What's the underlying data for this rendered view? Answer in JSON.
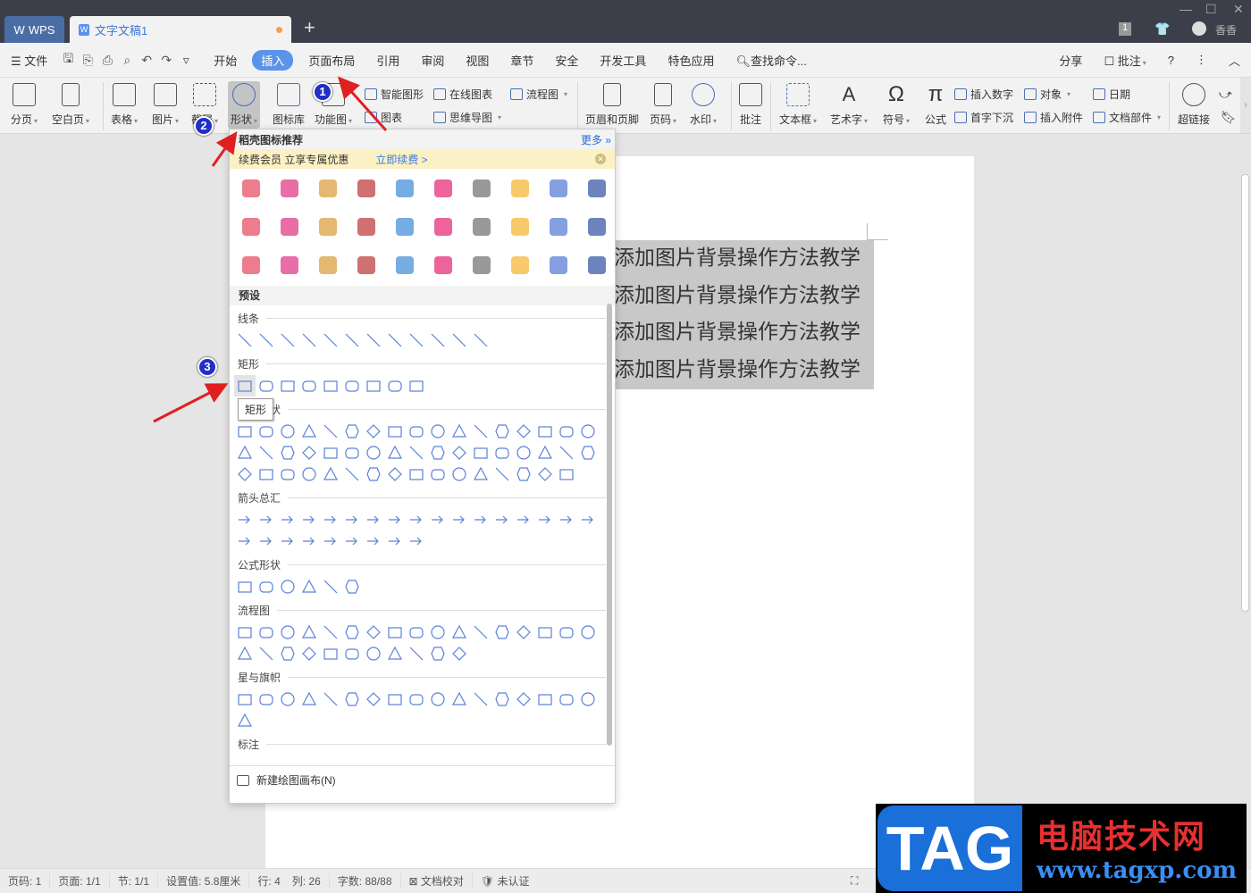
{
  "titlebar": {
    "app_tab": "WPS",
    "doc_tab": "文字文稿1",
    "user": "香香",
    "badge_count": "1"
  },
  "menu": {
    "file": "文件",
    "tabs": [
      "开始",
      "插入",
      "页面布局",
      "引用",
      "审阅",
      "视图",
      "章节",
      "安全",
      "开发工具",
      "特色应用"
    ],
    "search": "查找命令...",
    "share": "分享",
    "comment": "批注"
  },
  "ribbon": {
    "big": [
      "分页",
      "空白页",
      "表格",
      "图片",
      "截屏",
      "形状",
      "图标库",
      "功能图"
    ],
    "small1": [
      "智能图形",
      "图表"
    ],
    "small2": [
      "在线图表",
      "思维导图"
    ],
    "small3": [
      "流程图"
    ],
    "big2": [
      "页眉和页脚",
      "页码",
      "水印",
      "批注",
      "文本框",
      "艺术字",
      "符号",
      "公式"
    ],
    "small4": [
      "插入数字",
      "首字下沉"
    ],
    "small5": [
      "对象",
      "插入附件"
    ],
    "small6": [
      "日期",
      "文档部件"
    ],
    "big3": [
      "超链接"
    ]
  },
  "dropdown": {
    "header": "稻壳图标推荐",
    "more": "更多",
    "promo": "续费会员 立享专属优惠",
    "promo_link": "立即续费 >",
    "preset": "预设",
    "sections": [
      "线条",
      "矩形",
      "基本形状",
      "箭头总汇",
      "公式形状",
      "流程图",
      "星与旗帜",
      "标注"
    ],
    "tooltip": "矩形",
    "footer": "新建绘图画布(N)"
  },
  "document": {
    "lines": [
      "添加图片背景操作方法教学",
      "添加图片背景操作方法教学",
      "添加图片背景操作方法教学",
      "添加图片背景操作方法教学"
    ]
  },
  "annotations": [
    "1",
    "2",
    "3"
  ],
  "statusbar": [
    "页码: 1",
    "页面: 1/1",
    "节: 1/1",
    "设置值: 5.8厘米",
    "行: 4",
    "列: 26",
    "字数: 88/88",
    "文档校对",
    "未认证"
  ],
  "watermark": {
    "logo": "TAG",
    "site_name": "电脑技术网",
    "url": "www.tagxp.com"
  },
  "colors": {
    "accent": "#5b93e8",
    "shape_stroke": "#5b82d6",
    "arrow": "#e02020"
  }
}
